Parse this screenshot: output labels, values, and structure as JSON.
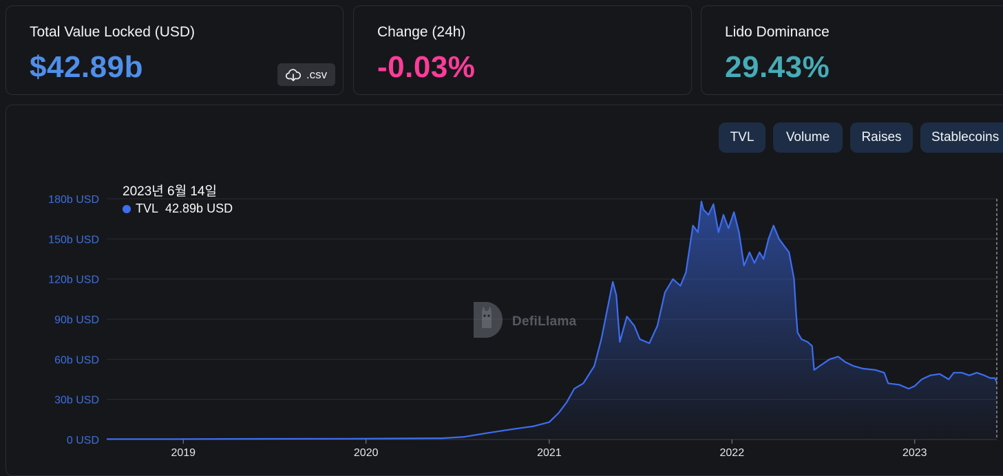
{
  "stats": {
    "tvl": {
      "label": "Total Value Locked (USD)",
      "value": "$42.89b",
      "color": "#4f8fea"
    },
    "change": {
      "label": "Change (24h)",
      "value": "-0.03%",
      "color": "#fd3c99"
    },
    "dominance": {
      "label": "Lido Dominance",
      "value": "29.43%",
      "color": "#46acb7"
    },
    "csv_label": ".csv",
    "csv_icon": "cloud-download-icon"
  },
  "tabs": [
    "TVL",
    "Volume",
    "Raises",
    "Stablecoins"
  ],
  "tooltip": {
    "date": "2023년 6월 14일",
    "series": "TVL",
    "value": "42.89b USD"
  },
  "watermark": {
    "text": "DefiLlama",
    "icon": "llama-logo-icon"
  },
  "colors": {
    "line": "#3d6ef0",
    "grid": "#2a2c33",
    "axis_label": "#3f6fd8",
    "year_label": "#e6e6e6"
  },
  "chart_data": {
    "type": "area",
    "title": "",
    "xlabel": "",
    "ylabel": "",
    "grid": true,
    "ylim": [
      0,
      180
    ],
    "y_unit": "b USD",
    "y_ticks": [
      0,
      30,
      60,
      90,
      120,
      150,
      180
    ],
    "y_tick_labels": [
      "0 USD",
      "30b USD",
      "60b USD",
      "90b USD",
      "120b USD",
      "150b USD",
      "180b USD"
    ],
    "x_ticks": [
      "2019-01-01",
      "2020-01-01",
      "2021-01-01",
      "2022-01-01",
      "2023-01-01"
    ],
    "x_tick_labels": [
      "2019",
      "2020",
      "2021",
      "2022",
      "2023"
    ],
    "series": [
      {
        "name": "TVL",
        "x": [
          "2018-08-01",
          "2018-12-01",
          "2019-06-01",
          "2019-12-01",
          "2020-03-15",
          "2020-06-01",
          "2020-07-15",
          "2020-09-01",
          "2020-10-15",
          "2020-12-01",
          "2021-01-01",
          "2021-01-20",
          "2021-02-05",
          "2021-02-20",
          "2021-03-10",
          "2021-04-01",
          "2021-04-15",
          "2021-05-08",
          "2021-05-15",
          "2021-05-22",
          "2021-06-05",
          "2021-06-20",
          "2021-07-01",
          "2021-07-20",
          "2021-08-05",
          "2021-08-20",
          "2021-09-05",
          "2021-09-20",
          "2021-10-01",
          "2021-10-15",
          "2021-10-25",
          "2021-11-01",
          "2021-11-05",
          "2021-11-15",
          "2021-11-25",
          "2021-12-05",
          "2021-12-15",
          "2021-12-25",
          "2022-01-05",
          "2022-01-15",
          "2022-01-25",
          "2022-02-05",
          "2022-02-15",
          "2022-02-25",
          "2022-03-05",
          "2022-03-15",
          "2022-03-25",
          "2022-04-05",
          "2022-04-15",
          "2022-04-25",
          "2022-05-05",
          "2022-05-09",
          "2022-05-12",
          "2022-05-20",
          "2022-06-01",
          "2022-06-10",
          "2022-06-14",
          "2022-06-25",
          "2022-07-15",
          "2022-08-01",
          "2022-08-15",
          "2022-09-01",
          "2022-09-20",
          "2022-10-15",
          "2022-11-01",
          "2022-11-09",
          "2022-12-01",
          "2022-12-20",
          "2023-01-01",
          "2023-01-15",
          "2023-02-01",
          "2023-02-20",
          "2023-03-10",
          "2023-03-20",
          "2023-04-05",
          "2023-04-20",
          "2023-05-05",
          "2023-05-20",
          "2023-06-01",
          "2023-06-10",
          "2023-06-14"
        ],
        "y": [
          0.3,
          0.3,
          0.5,
          0.6,
          0.8,
          1.0,
          2.0,
          5.0,
          7.5,
          10.0,
          13.0,
          20.0,
          28.0,
          38.0,
          42.0,
          55.0,
          75.0,
          118.0,
          108.0,
          73.0,
          92.0,
          85.0,
          75.0,
          72.0,
          85.0,
          110.0,
          120.0,
          115.0,
          125.0,
          160.0,
          155.0,
          178.0,
          172.0,
          168.0,
          176.0,
          155.0,
          168.0,
          158.0,
          170.0,
          155.0,
          130.0,
          140.0,
          132.0,
          140.0,
          135.0,
          150.0,
          160.0,
          150.0,
          145.0,
          140.0,
          120.0,
          95.0,
          80.0,
          75.0,
          73.0,
          70.0,
          52.0,
          55.0,
          60.0,
          62.0,
          58.0,
          55.0,
          53.0,
          52.0,
          50.0,
          42.0,
          41.0,
          38.0,
          40.0,
          45.0,
          48.0,
          49.0,
          45.0,
          50.0,
          50.0,
          48.0,
          50.0,
          48.0,
          46.0,
          46.0,
          42.89
        ]
      }
    ]
  }
}
